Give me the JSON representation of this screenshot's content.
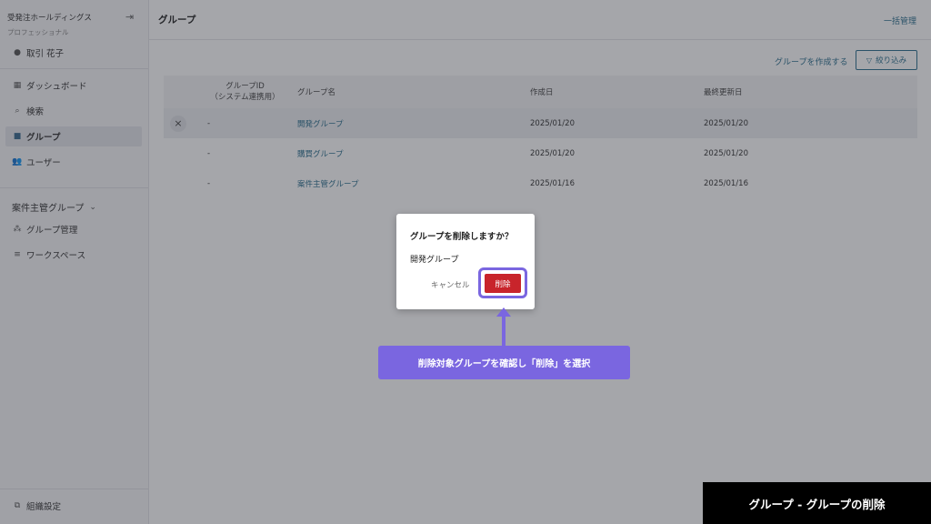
{
  "sidebar": {
    "org_name": "受発注ホールディングス",
    "plan": "プロフェッショナル",
    "user_name": "取引 花子",
    "items": [
      {
        "label": "ダッシュボード",
        "icon": "dashboard-icon"
      },
      {
        "label": "検索",
        "icon": "search-icon"
      },
      {
        "label": "グループ",
        "icon": "folder-icon"
      },
      {
        "label": "ユーザー",
        "icon": "users-icon"
      }
    ],
    "group_section": "案件主管グループ",
    "group_items": [
      {
        "label": "グループ管理",
        "icon": "group-manage-icon"
      },
      {
        "label": "ワークスペース",
        "icon": "list-icon"
      }
    ],
    "settings_label": "組織設定"
  },
  "header": {
    "title": "グループ",
    "bulk_manage": "一括管理"
  },
  "toolbar": {
    "create_group": "グループを作成する",
    "filter": "絞り込み"
  },
  "table": {
    "columns": [
      "グループID",
      "（システム連携用）",
      "グループ名",
      "作成日",
      "最終更新日"
    ],
    "rows": [
      {
        "id": "-",
        "name": "開発グループ",
        "created": "2025/01/20",
        "updated": "2025/01/20"
      },
      {
        "id": "-",
        "name": "購買グループ",
        "created": "2025/01/20",
        "updated": "2025/01/20"
      },
      {
        "id": "-",
        "name": "案件主管グループ",
        "created": "2025/01/16",
        "updated": "2025/01/16"
      }
    ]
  },
  "dialog": {
    "title": "グループを削除しますか？",
    "group_name": "開発グループ",
    "cancel": "キャンセル",
    "delete": "削除"
  },
  "callout": {
    "text": "削除対象グループを確認し「削除」を選択"
  },
  "footer_label": "グループ - グループの削除",
  "colors": {
    "accent": "#2b6f8e",
    "danger": "#c8242b",
    "highlight": "#7a66e0"
  }
}
